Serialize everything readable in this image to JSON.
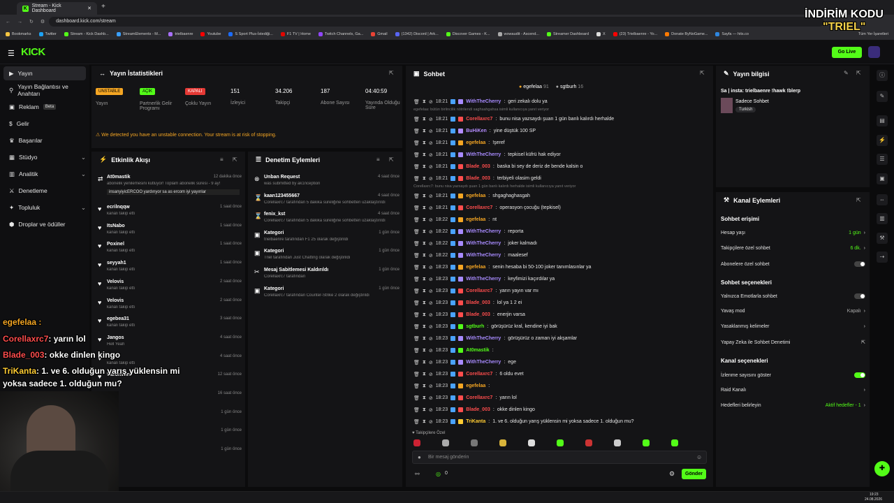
{
  "browser": {
    "tab_title": "Stream - Kick Dashboard",
    "url": "dashboard.kick.com/stream",
    "bookmarks": [
      "Bookmarks",
      "Twitter",
      "Stream - Kick Dashb...",
      "StreamElements - M...",
      "trielbaenre",
      "Youtube",
      "S Sport Plus-İstediği...",
      "F1 TV | Home",
      "Twitch Channels, Ga...",
      "Gmail",
      "(1342) Discord | Ark...",
      "Discover Games - K...",
      "wowaudit - Ascend...",
      "Streamer Dashboard",
      "X",
      "(23) Trielbaenre - Yo...",
      "Donate ByNoGame...",
      "Sayfa — hits.co"
    ],
    "all_bookmarks": "Tüm Yer İşaretleri"
  },
  "header": {
    "logo": "KICK",
    "go_live": "Go Live"
  },
  "sidebar": {
    "items": [
      {
        "label": "Yayın"
      },
      {
        "label": "Yayın Bağlantısı ve Anahtarı"
      },
      {
        "label": "Reklam",
        "badge": "Beta"
      },
      {
        "label": "Gelir"
      },
      {
        "label": "Başarılar"
      },
      {
        "label": "Stüdyo"
      },
      {
        "label": "Analitik"
      },
      {
        "label": "Denetleme"
      },
      {
        "label": "Topluluk"
      },
      {
        "label": "Droplar ve ödüller"
      }
    ]
  },
  "stats": {
    "title": "Yayın İstatistikleri",
    "items": [
      {
        "pill": "UNSTABLE",
        "label": "Yayın",
        "color": "#f5a623"
      },
      {
        "pill": "AÇIK",
        "label": "Partnerlik Gelir Programı",
        "color": "#53fc18"
      },
      {
        "pill": "KAPALI",
        "label": "Çoklu Yayın",
        "color": "#e53935"
      },
      {
        "value": "151",
        "label": "İzleyici"
      },
      {
        "value": "34.206",
        "label": "Takipçi"
      },
      {
        "value": "187",
        "label": "Abone Sayısı"
      },
      {
        "value": "04:40:59",
        "label": "Yayında Olduğu Süre"
      }
    ],
    "warning": "We detected you have an unstable connection. Your stream is at risk of stopping."
  },
  "events": {
    "title": "Etkinlik Akışı",
    "items": [
      {
        "name": "At0mastik",
        "desc": "abonelik yenilemesini kutluyor! Toplam abonelik süresi - 9 ay!",
        "msg": "insanyiyicERCOO yardınyor sa as ercom iyi yayınlar",
        "time": "12 dakika önce"
      },
      {
        "name": "ecrilnqqw",
        "desc": "kanalı takip etti",
        "time": "1 saat önce"
      },
      {
        "name": "ItsNabo",
        "desc": "kanalı takip etti",
        "time": "1 saat önce"
      },
      {
        "name": "Poxinel",
        "desc": "kanalı takip etti",
        "time": "1 saat önce"
      },
      {
        "name": "seyyah1",
        "desc": "kanalı takip etti",
        "time": "1 saat önce"
      },
      {
        "name": "Velovis",
        "desc": "kanalı takip etti",
        "time": "2 saat önce"
      },
      {
        "name": "Velovis",
        "desc": "kanalı takip etti",
        "time": "2 saat önce"
      },
      {
        "name": "egebea31",
        "desc": "kanalı takip etti",
        "time": "3 saat önce"
      },
      {
        "name": "Jangos",
        "desc": "Hell Yeah",
        "time": "4 saat önce"
      },
      {
        "name": "",
        "desc": "kanalı takip etti",
        "time": "4 saat önce"
      },
      {
        "name": "BaronWin",
        "desc": "",
        "time": "12 saat önce"
      },
      {
        "name": "",
        "desc": "",
        "time": "16 saat önce"
      },
      {
        "name": "",
        "desc": "",
        "time": "1 gün önce"
      },
      {
        "name": "",
        "desc": "",
        "time": "1 gün önce"
      },
      {
        "name": "",
        "desc": "",
        "time": "1 gün önce"
      }
    ]
  },
  "moderation": {
    "title": "Denetim Eylemleri",
    "items": [
      {
        "name": "Unban Request",
        "desc": "was submitted by ak1nception",
        "time": "4 saat önce"
      },
      {
        "name": "kaan123455667",
        "desc": "Corellaxrc7 tarafından 5 dakika süreliğine sohbetten uzaklaştırıldı",
        "time": "4 saat önce"
      },
      {
        "name": "fenix_kst",
        "desc": "Corellaxrc7 tarafından 5 dakika süreliğine sohbetten uzaklaştırıldı",
        "time": "4 saat önce"
      },
      {
        "name": "Kategori",
        "desc": "trielbaenre tarafından F1 25 olarak değiştirildi",
        "time": "1 gün önce"
      },
      {
        "name": "Kategori",
        "desc": "Triel tarafından Just Chatting olarak değiştirildi",
        "time": "1 gün önce"
      },
      {
        "name": "Mesaj Sabitlemesi Kaldırıldı",
        "desc": "Corellaxrc7 tarafından",
        "time": "1 gün önce"
      },
      {
        "name": "Kategori",
        "desc": "Corellaxrc7 tarafından Counter-Strike 2 olarak değiştirildi",
        "time": "1 gün önce"
      }
    ]
  },
  "chat": {
    "title": "Sohbet",
    "top_users": [
      {
        "name": "egefelaa",
        "count": "91"
      },
      {
        "name": "sgtburh",
        "count": "16"
      }
    ],
    "messages": [
      {
        "time": "18:21",
        "user": "WithTheCherry",
        "color": "#a88bff",
        "text": "geri zekalı dolu ya"
      },
      {
        "system": "egefelaa: bütün birlincilik nötrilendi saghsahgahsa isimli kullanıcıya yanıt veriyor"
      },
      {
        "time": "18:21",
        "user": "Corellaxrc7",
        "color": "#ff4d4d",
        "text": "bunu nisa yazsaydı şuan 1 gün banlı kalırdı herhalde"
      },
      {
        "time": "18:21",
        "user": "BuHiKen",
        "color": "#b48cff",
        "text": "yine düştük 100 SP"
      },
      {
        "time": "18:21",
        "user": "egefelaa",
        "color": "#f5a623",
        "text": "!şeref"
      },
      {
        "time": "18:21",
        "user": "WithTheCherry",
        "color": "#a88bff",
        "text": "tepkisel küfrü hak ediyor"
      },
      {
        "time": "18:21",
        "user": "Blade_003",
        "color": "#ff4d4d",
        "text": "baska bi sey de deriz de bende kalsin o"
      },
      {
        "time": "18:21",
        "user": "Blade_003",
        "color": "#ff4d4d",
        "text": "terbiyeli olasim geldi"
      },
      {
        "system": "Corellaxrc7: bunu nisa yazsaydı şuan 1 gün banlı kalırdı herhalde isimli kullanıcıya yanıt veriyor"
      },
      {
        "time": "18:21",
        "user": "egefelaa",
        "color": "#f5a623",
        "text": "shgaghaghasgah"
      },
      {
        "time": "18:21",
        "user": "Corellaxrc7",
        "color": "#ff4d4d",
        "text": "operasyon çocuğu (tepkisel)"
      },
      {
        "time": "18:22",
        "user": "egefelaa",
        "color": "#f5a623",
        "text": "nt"
      },
      {
        "time": "18:22",
        "user": "WithTheCherry",
        "color": "#a88bff",
        "text": "reporta"
      },
      {
        "time": "18:22",
        "user": "WithTheCherry",
        "color": "#a88bff",
        "text": "joker kalmadı"
      },
      {
        "time": "18:22",
        "user": "WithTheCherry",
        "color": "#a88bff",
        "text": "maalesef"
      },
      {
        "time": "18:23",
        "user": "egefelaa",
        "color": "#f5a623",
        "text": "senin hesaba bi 50-100 joker tanımlasınlar ya"
      },
      {
        "time": "18:23",
        "user": "WithTheCherry",
        "color": "#a88bff",
        "text": "keyfimizi kaçırdılar ya"
      },
      {
        "time": "18:23",
        "user": "Corellaxrc7",
        "color": "#ff4d4d",
        "text": "yarın yayın var mı"
      },
      {
        "time": "18:23",
        "user": "Blade_003",
        "color": "#ff4d4d",
        "text": "lol ya 1 2 ei"
      },
      {
        "time": "18:23",
        "user": "Blade_003",
        "color": "#ff4d4d",
        "text": "enerjin varsa"
      },
      {
        "time": "18:23",
        "user": "sgtburh",
        "color": "#53fc18",
        "text": "görüşürüz kral, kendine iyi bak"
      },
      {
        "time": "18:23",
        "user": "WithTheCherry",
        "color": "#a88bff",
        "text": "görüşürüz o zaman iyi akşamlar"
      },
      {
        "time": "18:23",
        "user": "At0mastik",
        "color": "#53fc18",
        "text": ""
      },
      {
        "time": "18:23",
        "user": "WithTheCherry",
        "color": "#a88bff",
        "text": "ege"
      },
      {
        "time": "18:23",
        "user": "Corellaxrc7",
        "color": "#ff4d4d",
        "text": "6 oldu evet"
      },
      {
        "time": "18:23",
        "user": "egefelaa",
        "color": "#f5a623",
        "text": ""
      },
      {
        "time": "18:23",
        "user": "Corellaxrc7",
        "color": "#ff4d4d",
        "text": "yarın lol"
      },
      {
        "time": "18:23",
        "user": "Blade_003",
        "color": "#ff4d4d",
        "text": "okke dinlen kingo"
      },
      {
        "time": "18:23",
        "user": "TriKanta",
        "color": "#ffcc33",
        "text": "1. ve 6. olduğun yarış yüklensin mi yoksa sadece 1. olduğun mu?"
      }
    ],
    "followers_only": "Takipçilere Özel",
    "input_placeholder": "Bir mesaj gönderin",
    "send": "Gönder",
    "count": "0"
  },
  "stream_info": {
    "title": "Yayın bilgisi",
    "stream_title": "Sa | insta: trielbaenre !hawk !blerp",
    "category": "Sadece Sohbet",
    "tag": "Turkish"
  },
  "channel_actions": {
    "title": "Kanal Eylemleri",
    "chat_access": "Sohbet erişimi",
    "rows1": [
      {
        "label": "Hesap yaşı",
        "value": "1 gün"
      },
      {
        "label": "Takipçilere özel sohbet",
        "value": "6 dk."
      },
      {
        "label": "Abonelere özel sohbet",
        "value": ""
      }
    ],
    "chat_options": "Sohbet seçenekleri",
    "rows2": [
      {
        "label": "Yalnızca Emotlarla sohbet",
        "value": ""
      },
      {
        "label": "Yavaş mod",
        "value": "Kapalı"
      },
      {
        "label": "Yasaklanmış kelimeler",
        "value": ""
      },
      {
        "label": "Yapay Zeka ile Sohbet Denetimi",
        "value": ""
      }
    ],
    "channel_options": "Kanal seçenekleri",
    "rows3": [
      {
        "label": "İzlenme sayısını göster",
        "value": ""
      },
      {
        "label": "Raid Kanalı",
        "value": ""
      },
      {
        "label": "Hedefleri belirleyin",
        "value": "Aktif hedefler - 1"
      }
    ]
  },
  "overlay": {
    "promo_line1": "İNDİRİM KODU",
    "promo_line2": "\"TRIEL\"",
    "chat": [
      {
        "user": "egefelaa :",
        "text": "",
        "color": "#f5a623"
      },
      {
        "user": "Corellaxrc7",
        "text": ": yarın lol",
        "color": "#ff4d4d"
      },
      {
        "user": "Blade_003",
        "text": ": okke dinlen kingo",
        "color": "#ff4d4d"
      },
      {
        "user": "TriKanta",
        "text": ": 1. ve 6. olduğun yarış yüklensin mi yoksa sadece 1. olduğun mu?",
        "color": "#ffcc33"
      }
    ]
  },
  "taskbar": {
    "time": "19:23",
    "date": "24.08.2026"
  }
}
